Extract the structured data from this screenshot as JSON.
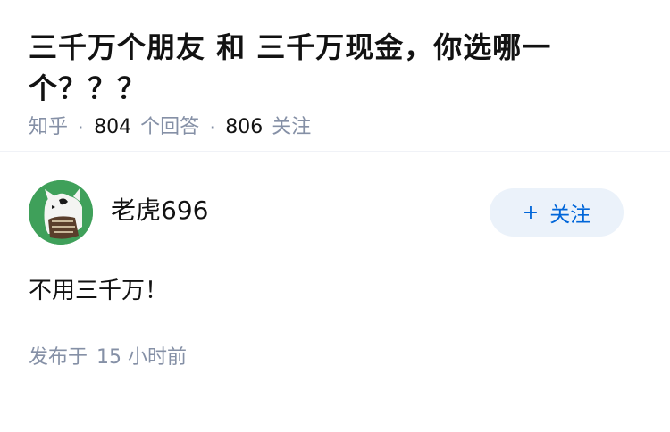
{
  "question": {
    "title": "三千万个朋友 和 三千万现金，你选哪一个？？？",
    "source": "知乎",
    "answer_count": "804",
    "answer_label": "个回答",
    "follower_count": "806",
    "follower_label": "关注"
  },
  "answer": {
    "author_name": "老虎696",
    "follow_button": {
      "icon": "+",
      "label": "关注"
    },
    "content": "不用三千万！",
    "published_prefix": "发布于",
    "published_time": "15 小时前"
  },
  "colors": {
    "accent": "#0066d9",
    "button_bg": "#ebf2fa",
    "meta_text": "#8590a6",
    "avatar_bg": "#3fa05a"
  }
}
